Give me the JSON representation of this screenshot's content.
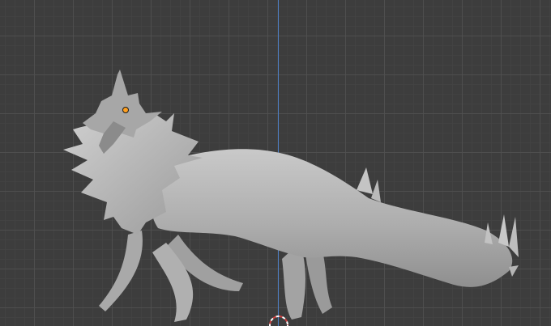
{
  "viewport": {
    "background_color": "#3d3d3d",
    "grid_color": "#505050",
    "z_axis_color": "#4f7fc4",
    "mesh_color": "#b9b9b9",
    "origin_color": "#ffa020",
    "cursor_colors": [
      "#d04040",
      "#ffffff"
    ]
  },
  "icons": {
    "origin": "object-origin-icon",
    "cursor": "3d-cursor-icon"
  }
}
